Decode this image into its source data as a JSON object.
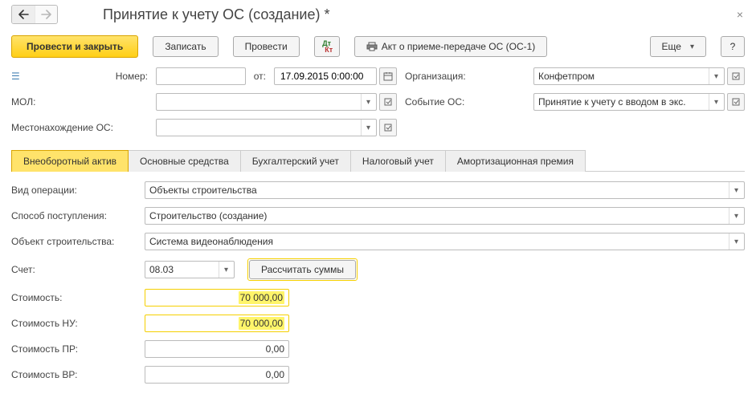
{
  "window": {
    "title": "Принятие к учету ОС (создание) *"
  },
  "toolbar": {
    "post_close": "Провести и закрыть",
    "save": "Записать",
    "post": "Провести",
    "print": "Акт о приеме-передаче ОС (ОС-1)",
    "more": "Еще",
    "help": "?"
  },
  "header": {
    "number_label": "Номер:",
    "from_label": "от:",
    "date": "17.09.2015 0:00:00",
    "org_label": "Организация:",
    "org_value": "Конфетпром",
    "mol_label": "МОЛ:",
    "event_label": "Событие ОС:",
    "event_value": "Принятие к учету с вводом в экс.",
    "location_label": "Местонахождение ОС:"
  },
  "tabs": [
    {
      "label": "Внеоборотный актив",
      "active": true
    },
    {
      "label": "Основные средства",
      "active": false
    },
    {
      "label": "Бухгалтерский учет",
      "active": false
    },
    {
      "label": "Налоговый учет",
      "active": false
    },
    {
      "label": "Амортизационная премия",
      "active": false
    }
  ],
  "pane": {
    "op_type_label": "Вид операции:",
    "op_type_value": "Объекты строительства",
    "method_label": "Способ поступления:",
    "method_value": "Строительство (создание)",
    "object_label": "Объект строительства:",
    "object_value": "Система видеонаблюдения",
    "account_label": "Счет:",
    "account_value": "08.03",
    "calc_btn": "Рассчитать суммы",
    "cost_label": "Стоимость:",
    "cost_value": "70 000,00",
    "cost_nu_label": "Стоимость НУ:",
    "cost_nu_value": "70 000,00",
    "cost_pr_label": "Стоимость ПР:",
    "cost_pr_value": "0,00",
    "cost_vr_label": "Стоимость ВР:",
    "cost_vr_value": "0,00"
  }
}
